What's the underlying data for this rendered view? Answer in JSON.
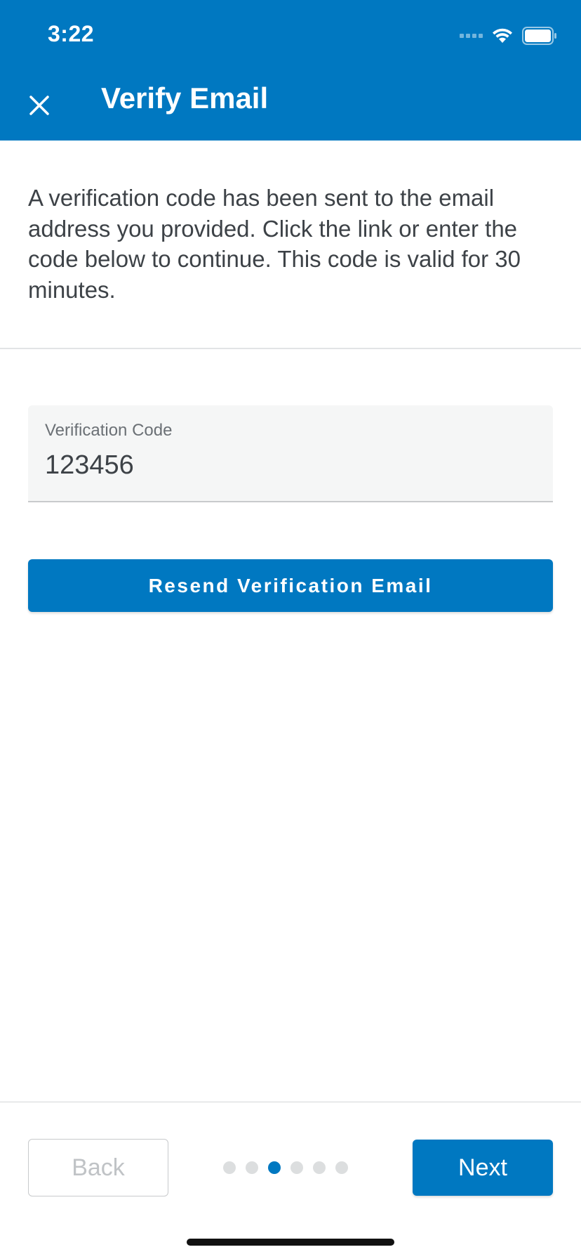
{
  "status_bar": {
    "time": "3:22"
  },
  "header": {
    "title": "Verify Email",
    "close_icon": "close-icon",
    "background": "#0078c1"
  },
  "intro": {
    "text": "A verification code has been sent to the email address you provided. Click the link or enter the code below to continue. This code is valid for 30 minutes."
  },
  "verification_field": {
    "label": "Verification Code",
    "value": "123456"
  },
  "resend_button": {
    "label": "Resend Verification Email"
  },
  "footer": {
    "back_label": "Back",
    "next_label": "Next",
    "steps_total": 6,
    "current_step": 3
  },
  "colors": {
    "accent": "#0078c1",
    "text": "#3d4247",
    "muted": "#c0c3c6"
  }
}
